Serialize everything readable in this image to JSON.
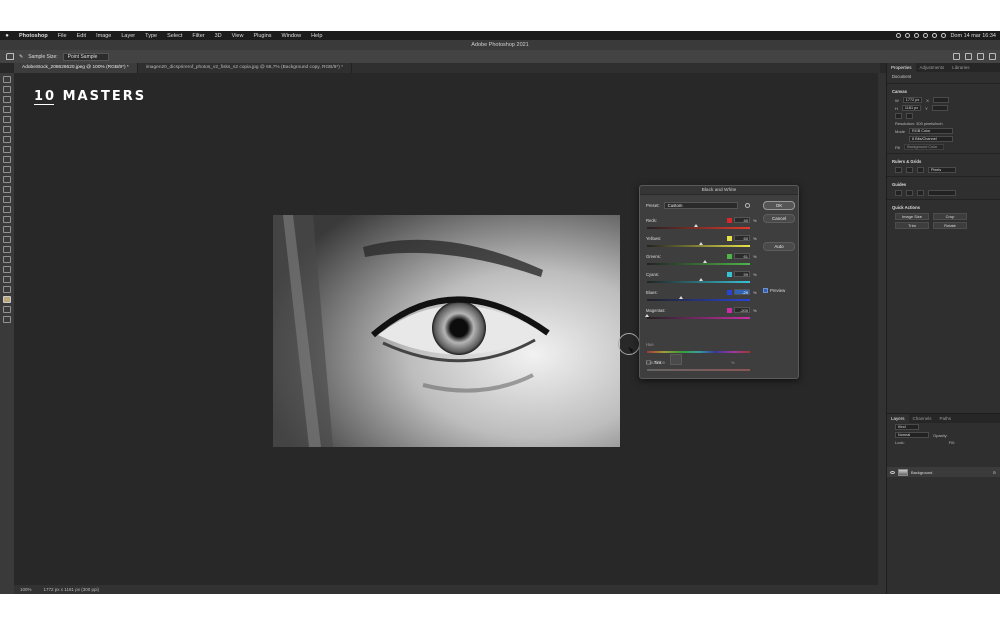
{
  "menubar": {
    "apple": "",
    "items": [
      "Photoshop",
      "File",
      "Edit",
      "Image",
      "Layer",
      "Type",
      "Select",
      "Filter",
      "3D",
      "View",
      "Plugins",
      "Window",
      "Help"
    ],
    "clock": "Dom 14 mar  16:34"
  },
  "titlebar": {
    "title": "Adobe Photoshop 2021"
  },
  "options": {
    "sample_size_label": "Sample Size:",
    "sample_size_value": "Point Sample"
  },
  "tabs": [
    "AdobeStock_208626620.jpeg @ 100% (RGB/8*) *",
    "imagen20_dicsprirerof_photos_v2_fisks_s2 copia.jpg @ 66,7% (Background copy, RGB/8*) *"
  ],
  "logo": "10 MASTERS",
  "statusbar": {
    "zoom": "100%",
    "doc_info": "1772 px x 1181 px (300 ppi)"
  },
  "properties": {
    "tabs": [
      "Properties",
      "Adjustments",
      "Libraries"
    ],
    "document_label": "Document",
    "canvas_title": "Canvas",
    "w_label": "W",
    "w_value": "1772 px",
    "x_label": "X",
    "h_label": "H",
    "h_value": "1181 px",
    "y_label": "Y",
    "resolution": "Resolution: 300 pixels/inch",
    "mode_label": "Mode",
    "mode_value": "RGB Color",
    "depth_value": "8 Bits/Channel",
    "fill_label": "Fill",
    "fill_value": "Background Color",
    "rulers_title": "Rulers & Grids",
    "rulers_unit": "Pixels",
    "guides_title": "Guides",
    "quick_actions_title": "Quick Actions",
    "quick_actions": [
      "Image Size",
      "Crop",
      "Trim",
      "Rotate"
    ]
  },
  "layers": {
    "tabs": [
      "Layers",
      "Channels",
      "Paths"
    ],
    "kind_label": "Kind",
    "mode_label": "Normal",
    "opacity_label": "Opacity:",
    "lock_label": "Lock:",
    "fill_label": "Fill:",
    "layer_name": "Background"
  },
  "dialog": {
    "title": "Black and White",
    "preset_label": "Preset:",
    "preset_value": "Custom",
    "ok": "OK",
    "cancel": "Cancel",
    "auto": "Auto",
    "preview": "Preview",
    "preview_checked": true,
    "sliders": [
      {
        "label": "Reds:",
        "value": "40",
        "percent": "%",
        "color": "#d8262a",
        "position": 0.48,
        "track": "linear-gradient(to right,#222,#e23a2a)"
      },
      {
        "label": "Yellows:",
        "value": "60",
        "percent": "%",
        "color": "#e6e34a",
        "position": 0.52,
        "track": "linear-gradient(to right,#222,#e6e34a)"
      },
      {
        "label": "Greens:",
        "value": "61",
        "percent": "%",
        "color": "#4fb548",
        "position": 0.56,
        "track": "linear-gradient(to right,#222,#4fb548)"
      },
      {
        "label": "Cyans:",
        "value": "59",
        "percent": "%",
        "color": "#37c2d4",
        "position": 0.52,
        "track": "linear-gradient(to right,#222,#37c2d4)"
      },
      {
        "label": "Blues:",
        "value": "-29",
        "percent": "%",
        "color": "#2645d8",
        "position": 0.33,
        "track": "linear-gradient(to right,#222,#2645d8)",
        "selected": true
      },
      {
        "label": "Magentas:",
        "value": "-200",
        "percent": "%",
        "color": "#c92ea7",
        "position": 0.0,
        "track": "linear-gradient(to right,#222,#c92ea7)"
      }
    ],
    "tint_label": "Tint",
    "hue_label": "Hue",
    "saturation_label": "Saturation",
    "saturation_percent": "%"
  }
}
